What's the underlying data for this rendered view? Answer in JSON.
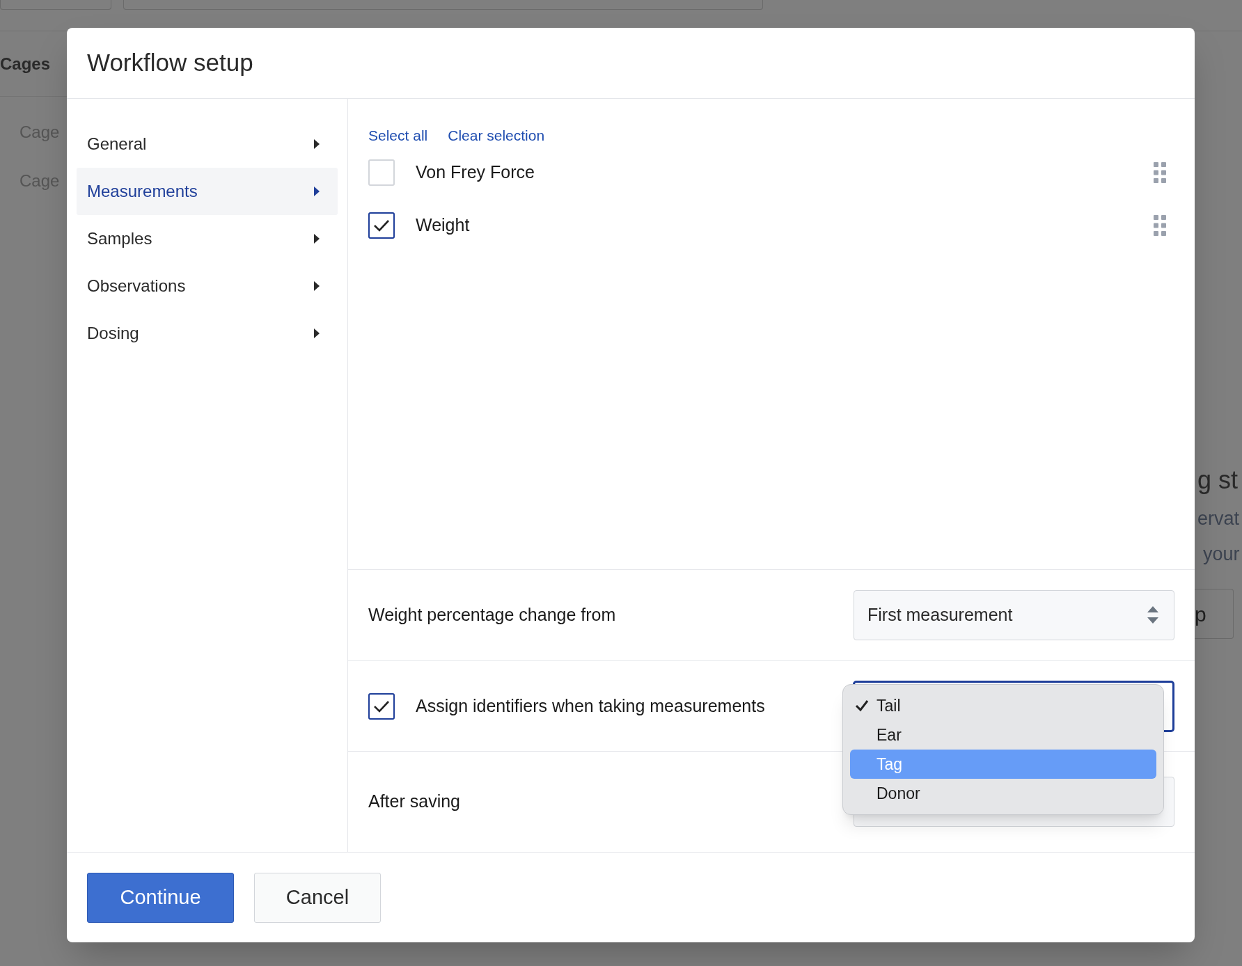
{
  "background": {
    "header": "Cages",
    "items": [
      "Cage",
      "Cage"
    ],
    "right_lines": [
      "g st",
      "ervat",
      "your"
    ],
    "right_button": "p"
  },
  "dialog": {
    "title": "Workflow setup",
    "nav": [
      {
        "label": "General",
        "selected": false
      },
      {
        "label": "Measurements",
        "selected": true
      },
      {
        "label": "Samples",
        "selected": false
      },
      {
        "label": "Observations",
        "selected": false
      },
      {
        "label": "Dosing",
        "selected": false
      }
    ],
    "links": [
      "Select all",
      "Clear selection"
    ],
    "measurements": [
      {
        "label": "Von Frey Force",
        "checked": false
      },
      {
        "label": "Weight",
        "checked": true
      }
    ],
    "weight_change": {
      "label": "Weight percentage change from",
      "value": "First measurement"
    },
    "assign": {
      "label": "Assign identifiers when taking measurements",
      "checked": true
    },
    "after_saving": {
      "label": "After saving"
    },
    "dropdown": [
      {
        "label": "Tail",
        "selected": true,
        "highlighted": false
      },
      {
        "label": "Ear",
        "selected": false,
        "highlighted": false
      },
      {
        "label": "Tag",
        "selected": false,
        "highlighted": true
      },
      {
        "label": "Donor",
        "selected": false,
        "highlighted": false
      }
    ],
    "buttons": [
      {
        "label": "Continue",
        "kind": "primary"
      },
      {
        "label": "Cancel",
        "kind": "secondary"
      }
    ]
  }
}
